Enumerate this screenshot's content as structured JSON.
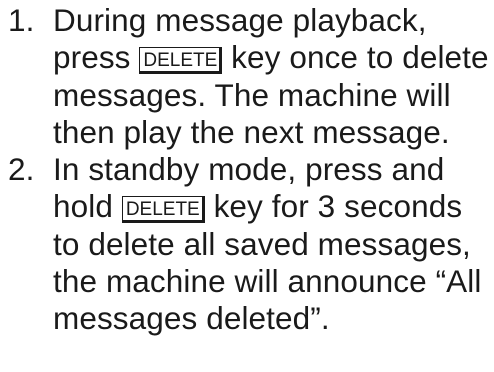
{
  "steps": [
    {
      "number": "1.",
      "before_key": "During message playback, press ",
      "key": "DELETE",
      "after_key": " key once to delete messages.  The machine will then play the next message."
    },
    {
      "number": "2.",
      "before_key": "In standby mode, press and hold ",
      "key": "DELETE",
      "after_key": " key for 3 seconds to delete all saved messages, the machine will announce “All messages deleted”."
    }
  ]
}
